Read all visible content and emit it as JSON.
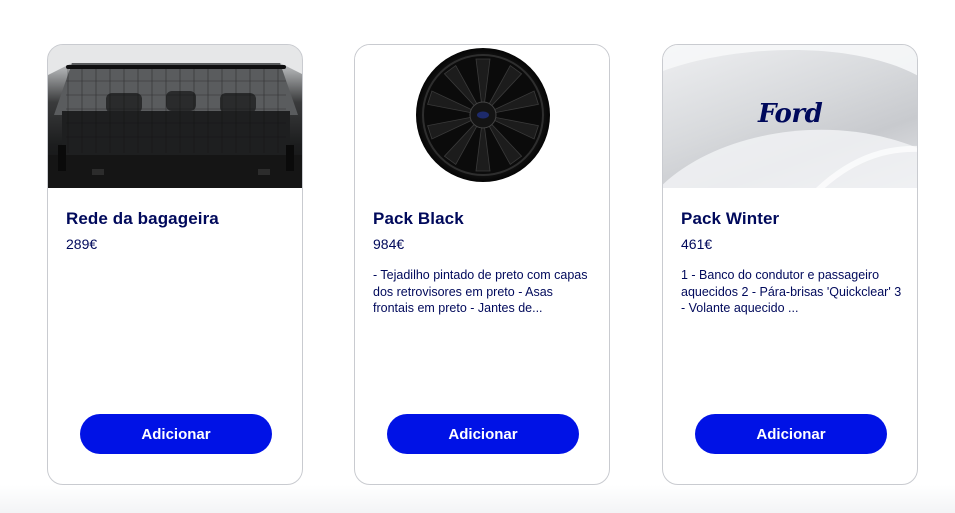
{
  "colors": {
    "brand_navy": "#00095b",
    "button_blue": "#0012e6",
    "card_border": "#c9cbd0"
  },
  "cards": [
    {
      "image_icon": "cargo-net-trunk-photo",
      "title": "Rede da bagageira",
      "price": "289€",
      "description": "",
      "button_label": "Adicionar"
    },
    {
      "image_icon": "black-alloy-wheel-photo",
      "title": "Pack Black",
      "price": "984€",
      "description": "- Tejadilho pintado de preto com capas dos retrovisores em preto - Asas frontais em preto - Jantes de...",
      "button_label": "Adicionar"
    },
    {
      "image_icon": "ford-logo-backdrop",
      "image_text": "Ford",
      "title": "Pack Winter",
      "price": "461€",
      "description": "1 - Banco do condutor e passageiro aquecidos 2 - Pára-brisas 'Quickclear' 3 - Volante aquecido ...",
      "button_label": "Adicionar"
    }
  ]
}
